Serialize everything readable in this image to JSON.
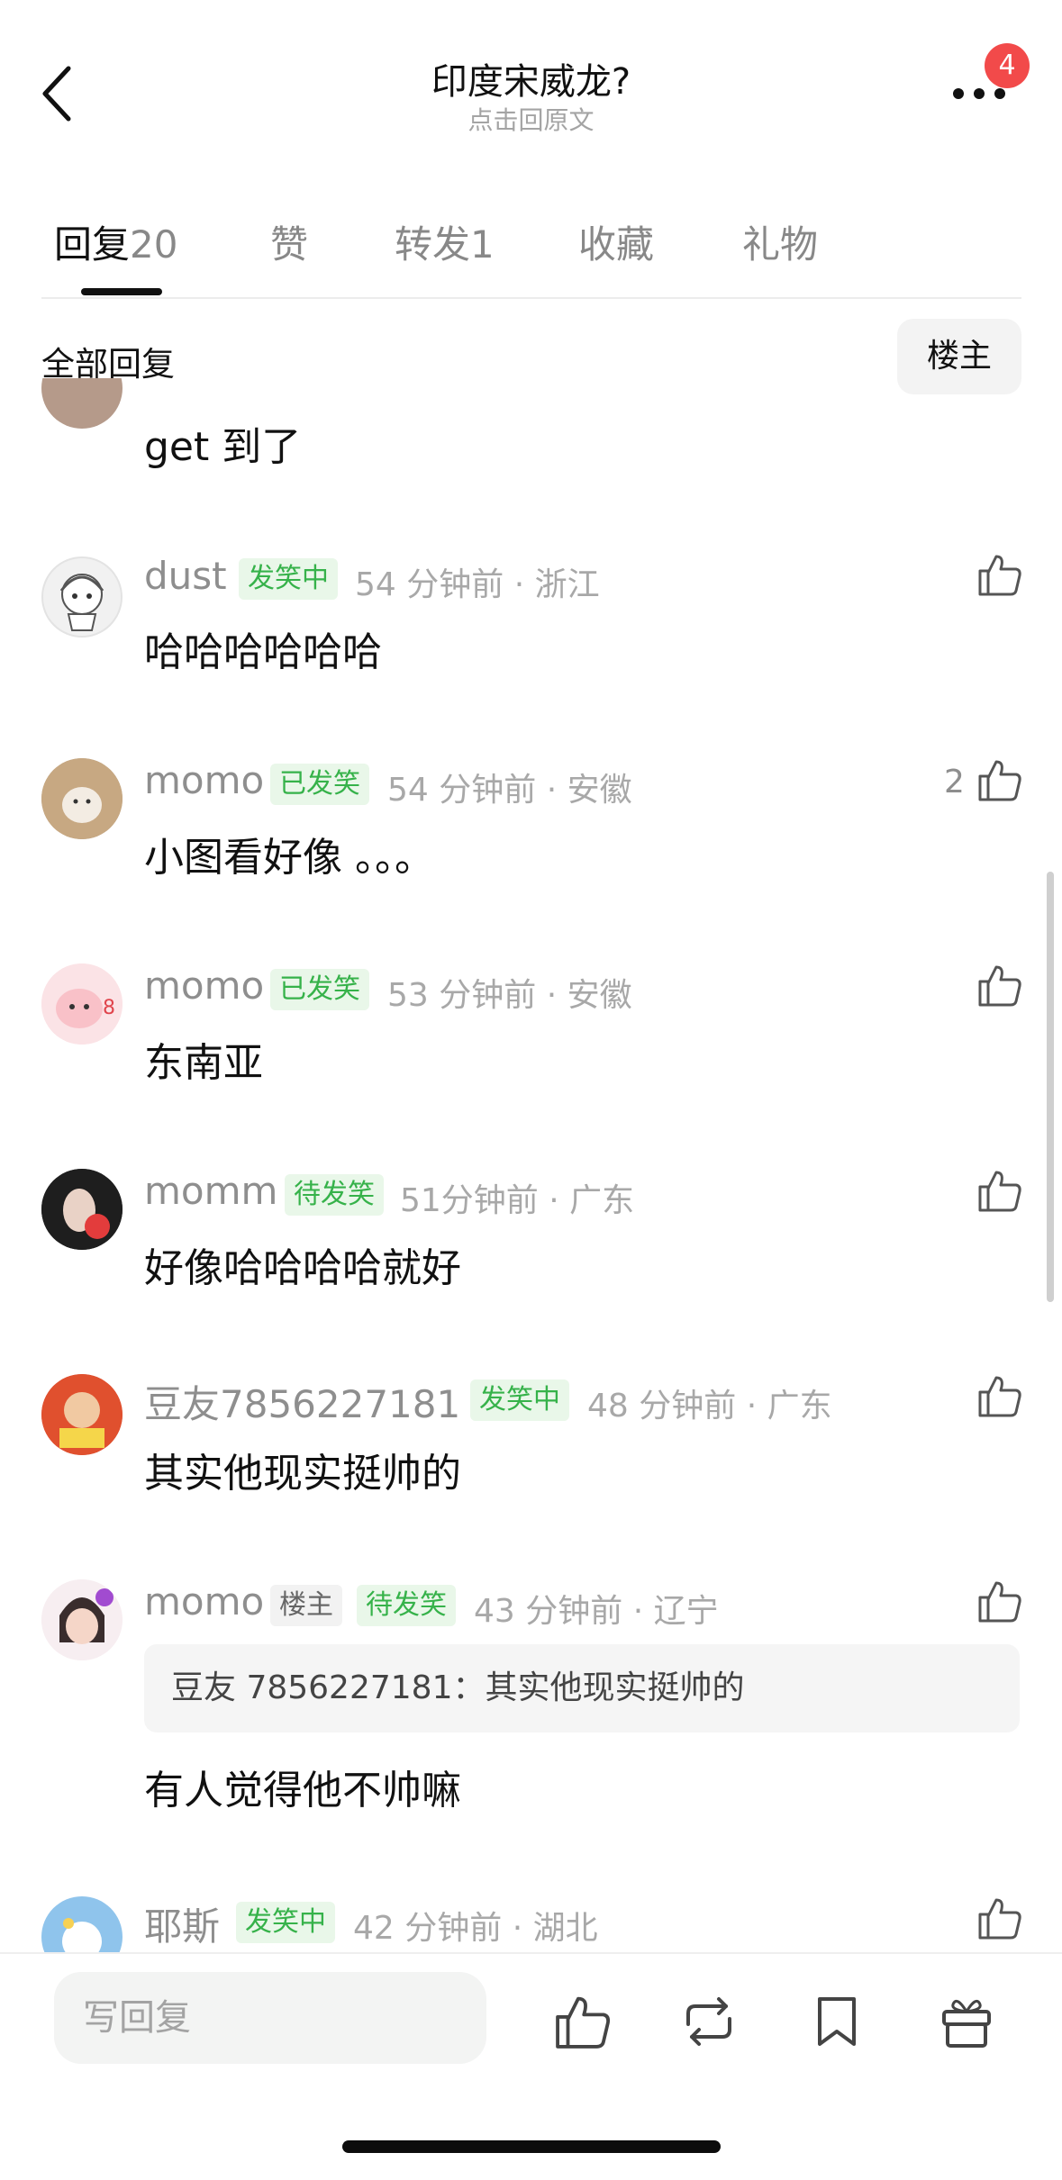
{
  "header": {
    "title": "印度宋威龙?",
    "subtitle": "点击回原文",
    "badge_count": "4",
    "back_icon": "chevron-left-icon",
    "more_icon": "more-dots-icon"
  },
  "tabs": [
    {
      "label": "回复",
      "count": "20",
      "active": true
    },
    {
      "label": "赞",
      "count": ""
    },
    {
      "label": "转发",
      "count": "1"
    },
    {
      "label": "收藏",
      "count": ""
    },
    {
      "label": "礼物",
      "count": ""
    }
  ],
  "filter": {
    "label": "全部回复",
    "louzhu_button": "楼主"
  },
  "comments": [
    {
      "text": "get 到了"
    },
    {
      "username": "dust",
      "tag": "发笑中",
      "meta": "54 分钟前 · 浙江",
      "text": "哈哈哈哈哈哈",
      "likes": ""
    },
    {
      "username": "momo",
      "tag": "已发笑",
      "meta": "54 分钟前 · 安徽",
      "text": "小图看好像 。。。",
      "likes": "2"
    },
    {
      "username": "momo",
      "tag": "已发笑",
      "meta": "53 分钟前 · 安徽",
      "text": "东南亚",
      "likes": ""
    },
    {
      "username": "momm",
      "tag": "待发笑",
      "meta": "51分钟前 · 广东",
      "text": "好像哈哈哈哈就好",
      "likes": ""
    },
    {
      "username": "豆友7856227181",
      "tag": "发笑中",
      "meta": "48 分钟前 · 广东",
      "text": "其实他现实挺帅的",
      "likes": ""
    },
    {
      "username": "momo",
      "owner_tag": "楼主",
      "tag": "待发笑",
      "meta": "43 分钟前 · 辽宁",
      "quote": "豆友 7856227181：其实他现实挺帅的",
      "text": "有人觉得他不帅嘛",
      "likes": ""
    },
    {
      "username": "耶斯",
      "tag": "发笑中",
      "meta": "42 分钟前 · 湖北",
      "likes": ""
    }
  ],
  "bottom_bar": {
    "reply_placeholder": "写回复",
    "icons": [
      "thumbs-up-icon",
      "repost-icon",
      "bookmark-icon",
      "gift-icon"
    ]
  },
  "colors": {
    "tag_green": "#36b24a",
    "tag_green_bg": "#e9f7e9",
    "badge_red": "#f24a4a"
  }
}
